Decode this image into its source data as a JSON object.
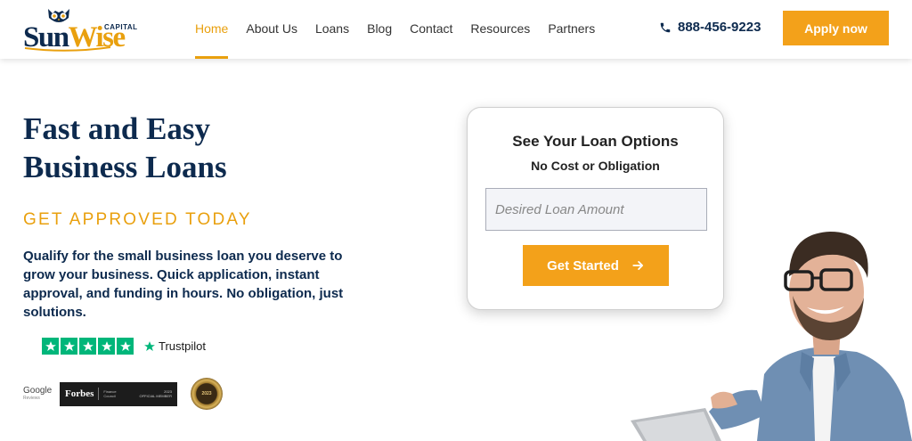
{
  "logo": {
    "sun": "Sun",
    "wise": "Wise",
    "capital": "CAPITAL"
  },
  "nav": [
    {
      "label": "Home",
      "active": true
    },
    {
      "label": "About Us"
    },
    {
      "label": "Loans"
    },
    {
      "label": "Blog"
    },
    {
      "label": "Contact"
    },
    {
      "label": "Resources"
    },
    {
      "label": "Partners"
    }
  ],
  "header": {
    "phone": "888-456-9223",
    "apply_label": "Apply now"
  },
  "hero": {
    "title_line1": "Fast and Easy",
    "title_line2": "Business Loans",
    "subtitle": "GET APPROVED TODAY",
    "description": "Qualify for the small business loan you deserve to grow your business. Quick application, instant approval, and funding in hours. No obligation, just solutions."
  },
  "trustpilot": {
    "label": "Trustpilot",
    "stars": 5
  },
  "badges": {
    "google": "Google",
    "google_sub": "Reviews",
    "forbes": "Forbes",
    "forbes_mid1": "Finance",
    "forbes_mid2": "Council",
    "forbes_year": "2023",
    "forbes_member": "OFFICIAL MEMBER",
    "seal": "2023"
  },
  "form": {
    "title": "See Your Loan Options",
    "subtitle": "No Cost or Obligation",
    "amount_placeholder": "Desired Loan Amount",
    "button_label": "Get Started"
  },
  "colors": {
    "navy": "#0d2a4e",
    "accent": "#f3a11a",
    "trustpilot_green": "#00b67a"
  },
  "icons": {
    "phone": "phone-icon",
    "arrow": "arrow-right-icon",
    "star": "star-icon"
  }
}
